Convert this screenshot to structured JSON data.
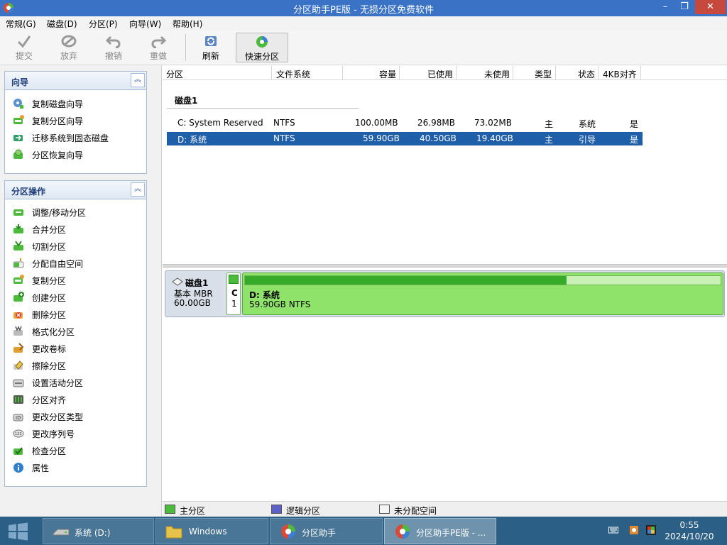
{
  "window": {
    "title": "分区助手PE版 - 无损分区免费软件",
    "minimize": "–",
    "maximize": "❐",
    "close": "✕"
  },
  "menu": [
    "常规(G)",
    "磁盘(D)",
    "分区(P)",
    "向导(W)",
    "帮助(H)"
  ],
  "toolbar": {
    "commit": "提交",
    "discard": "放弃",
    "undo": "撤销",
    "redo": "重做",
    "refresh": "刷新",
    "quick_partition": "快速分区"
  },
  "wizard_panel": {
    "title": "向导",
    "collapse": "︽",
    "items": [
      "复制磁盘向导",
      "复制分区向导",
      "迁移系统到固态磁盘",
      "分区恢复向导"
    ]
  },
  "ops_panel": {
    "title": "分区操作",
    "collapse": "︽",
    "items": [
      "调整/移动分区",
      "合并分区",
      "切割分区",
      "分配自由空间",
      "复制分区",
      "创建分区",
      "删除分区",
      "格式化分区",
      "更改卷标",
      "擦除分区",
      "设置活动分区",
      "分区对齐",
      "更改分区类型",
      "更改序列号",
      "检查分区",
      "属性"
    ]
  },
  "table": {
    "columns": [
      "分区",
      "文件系统",
      "容量",
      "已使用",
      "未使用",
      "类型",
      "状态",
      "4KB对齐"
    ],
    "disk_label": "磁盘1",
    "rows": [
      {
        "partition": "C: System Reserved",
        "fs": "NTFS",
        "capacity": "100.00MB",
        "used": "26.98MB",
        "unused": "73.02MB",
        "type": "主",
        "status": "系统",
        "aligned": "是"
      },
      {
        "partition": "D: 系统",
        "fs": "NTFS",
        "capacity": "59.90GB",
        "used": "40.50GB",
        "unused": "19.40GB",
        "type": "主",
        "status": "引导",
        "aligned": "是"
      }
    ]
  },
  "diskmap": {
    "name": "磁盘1",
    "type": "基本 MBR",
    "size": "60.00GB",
    "small_partition": {
      "letter": "C",
      "num": "1"
    },
    "big_partition": {
      "name": "D: 系统",
      "info": "59.90GB NTFS",
      "used_fraction": 0.676
    }
  },
  "legend": {
    "primary": "主分区",
    "logical": "逻辑分区",
    "unallocated": "未分配空间",
    "colors": {
      "primary": "#4cba3a",
      "logical": "#5b5fc7",
      "unallocated": "#f4f4f4"
    }
  },
  "taskbar": {
    "tasks": [
      "系统 (D:)",
      "Windows",
      "分区助手",
      "分区助手PE版 - ..."
    ],
    "time": "0:55",
    "date": "2024/10/20"
  }
}
